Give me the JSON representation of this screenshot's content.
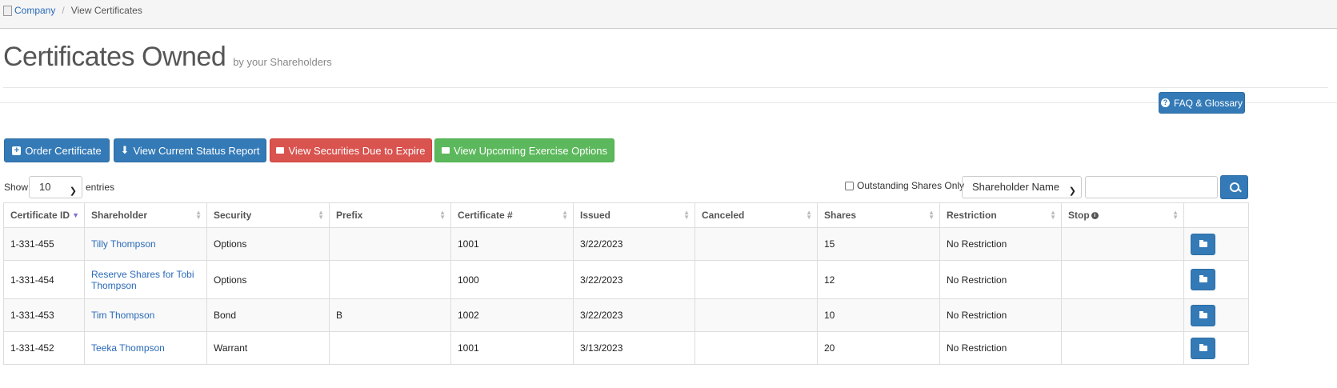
{
  "breadcrumb": {
    "home": "Company",
    "separator": "/",
    "current": "View Certificates"
  },
  "page": {
    "title": "Certificates Owned",
    "subtitle": "by your Shareholders"
  },
  "faq_button": {
    "icon": "question-circle-icon",
    "label": "FAQ & Glossary"
  },
  "actions": [
    {
      "icon": "plus-square-icon",
      "label": "Order Certificate",
      "color": "#337ab7"
    },
    {
      "icon": "download-icon",
      "label": "View Current Status Report",
      "color": "#337ab7"
    },
    {
      "icon": "id-card-icon",
      "label": "View Securities Due to Expire",
      "color": "#d9534f"
    },
    {
      "icon": "id-card-icon",
      "label": "View Upcoming Exercise Options",
      "color": "#5cb85c"
    }
  ],
  "table_controls": {
    "show_label": "Show",
    "entries_value": "10",
    "entries_label": "entries",
    "outstanding_label": "Outstanding Shares Only",
    "filter_select_value": "Shareholder Name",
    "search_value": ""
  },
  "table": {
    "columns": [
      "Certificate ID",
      "Shareholder",
      "Security",
      "Prefix",
      "Certificate #",
      "Issued",
      "Canceled",
      "Shares",
      "Restriction",
      "Stop",
      ""
    ],
    "rows": [
      {
        "certificate_id": "1-331-455",
        "shareholder": "Tilly Thompson",
        "security": "Options",
        "prefix": "",
        "certificate_no": "1001",
        "issued": "3/22/2023",
        "canceled": "",
        "shares": "15",
        "restriction": "No Restriction",
        "stop": ""
      },
      {
        "certificate_id": "1-331-454",
        "shareholder": "Reserve Shares for Tobi Thompson",
        "security": "Options",
        "prefix": "",
        "certificate_no": "1000",
        "issued": "3/22/2023",
        "canceled": "",
        "shares": "12",
        "restriction": "No Restriction",
        "stop": ""
      },
      {
        "certificate_id": "1-331-453",
        "shareholder": "Tim Thompson",
        "security": "Bond",
        "prefix": "B",
        "certificate_no": "1002",
        "issued": "3/22/2023",
        "canceled": "",
        "shares": "10",
        "restriction": "No Restriction",
        "stop": ""
      },
      {
        "certificate_id": "1-331-452",
        "shareholder": "Teeka Thompson",
        "security": "Warrant",
        "prefix": "",
        "certificate_no": "1001",
        "issued": "3/13/2023",
        "canceled": "",
        "shares": "20",
        "restriction": "No Restriction",
        "stop": ""
      }
    ]
  }
}
